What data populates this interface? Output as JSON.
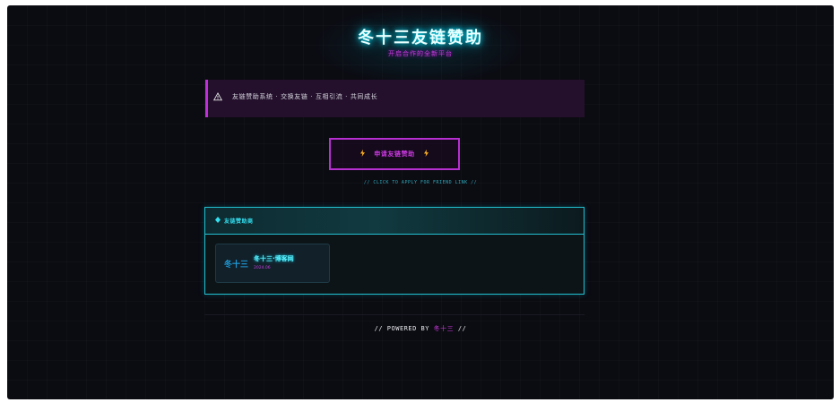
{
  "header": {
    "title": "冬十三友链赞助",
    "subtitle": "开启合作的全新平台"
  },
  "notice": {
    "icon": "warning-icon",
    "text": "友链赞助系统 · 交换友链 · 互相引流 · 共同成长"
  },
  "apply": {
    "label": "申请友链赞助",
    "icon": "lightning-icon",
    "hint": "// CLICK TO APPLY FOR FRIEND LINK //"
  },
  "sponsors": {
    "header_icon": "diamond-icon",
    "title": "友链赞助商",
    "items": [
      {
        "logo": "冬十三",
        "name": "冬十三·博客网",
        "sub": "2024.06"
      }
    ]
  },
  "footer": {
    "prefix": "// POWERED BY ",
    "brand": "冬十三",
    "suffix": " //"
  },
  "colors": {
    "background": "#0b0b12",
    "cyan": "#22c0d0",
    "magenta": "#c030d8",
    "accent": "#ffb020"
  }
}
